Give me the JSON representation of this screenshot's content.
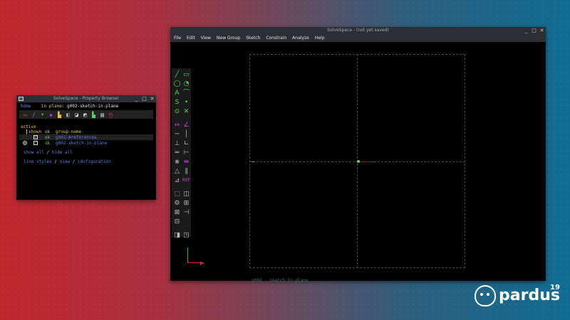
{
  "property_browser": {
    "title": "SolveSpace - Property Browser",
    "nav": {
      "home": "home",
      "in_plane_label": "in plane:",
      "in_plane_value": "g002-sketch-in-plane"
    },
    "active_label": "active",
    "columns": {
      "shown": "shown",
      "ok": "ok",
      "group_name": "group-name"
    },
    "groups": [
      {
        "ok": "ok",
        "name": "g001-#references",
        "shown": true,
        "active": false
      },
      {
        "ok": "ok",
        "name": "g002-sketch-in-plane",
        "shown": true,
        "active": true
      }
    ],
    "show_all": "show all",
    "hide_all": "hide all",
    "slash": "/",
    "line_styles": "line styles",
    "view": "view",
    "configuration": "configuration"
  },
  "main_window": {
    "title": "SolveSpace - (not yet saved)",
    "menu": [
      "File",
      "Edit",
      "View",
      "New Group",
      "Sketch",
      "Constrain",
      "Analyze",
      "Help"
    ],
    "plane_label": "g002 · sketch-in-plane"
  },
  "window_buttons": {
    "minimize": "_",
    "maximize": "□",
    "close": "✕"
  },
  "brand": {
    "name": "pardus",
    "version": "19"
  },
  "colors": {
    "accent_green": "#5fd35f",
    "accent_yellow": "#e8c23c",
    "link_blue": "#5a7fe6",
    "axis_red": "#e02020"
  }
}
